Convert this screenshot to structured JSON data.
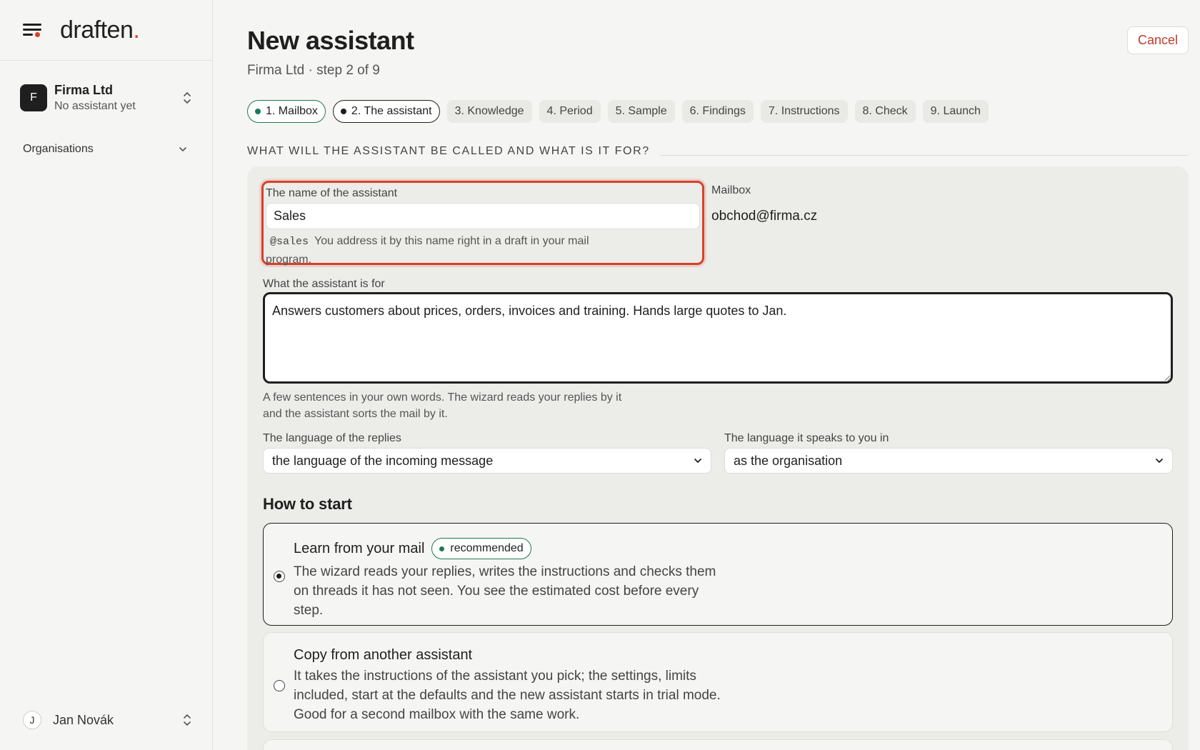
{
  "brand": {
    "logo_text": "draften",
    "logo_dot": "."
  },
  "org": {
    "initial": "F",
    "name": "Firma Ltd",
    "status": "No assistant yet"
  },
  "nav": {
    "organisations_label": "Organisations"
  },
  "user": {
    "initial": "J",
    "name": "Jan Novák"
  },
  "page": {
    "title": "New assistant",
    "subtitle": "Firma Ltd · step 2 of 9",
    "cancel_label": "Cancel"
  },
  "steps": [
    {
      "label": "1. Mailbox",
      "state": "done"
    },
    {
      "label": "2. The assistant",
      "state": "current"
    },
    {
      "label": "3. Knowledge",
      "state": "todo"
    },
    {
      "label": "4. Period",
      "state": "todo"
    },
    {
      "label": "5. Sample",
      "state": "todo"
    },
    {
      "label": "6. Findings",
      "state": "todo"
    },
    {
      "label": "7. Instructions",
      "state": "todo"
    },
    {
      "label": "8. Check",
      "state": "todo"
    },
    {
      "label": "9. Launch",
      "state": "todo"
    }
  ],
  "section": {
    "heading": "WHAT WILL THE ASSISTANT BE CALLED AND WHAT IS IT FOR?"
  },
  "form": {
    "name_label": "The name of the assistant",
    "name_value": "Sales",
    "name_handle": "@sales",
    "name_hint": "You address it by this name right in a draft in your mail program.",
    "mailbox_label": "Mailbox",
    "mailbox_value": "obchod@firma.cz",
    "purpose_label": "What the assistant is for",
    "purpose_value": "Answers customers about prices, orders, invoices and training. Hands large quotes to Jan.",
    "purpose_hint": "A few sentences in your own words. The wizard reads your replies by it and the assistant sorts the mail by it.",
    "reply_lang_label": "The language of the replies",
    "reply_lang_value": "the language of the incoming message",
    "ui_lang_label": "The language it speaks to you in",
    "ui_lang_value": "as the organisation"
  },
  "start": {
    "heading": "How to start",
    "options": [
      {
        "title": "Learn from your mail",
        "badge": "recommended",
        "description": "The wizard reads your replies, writes the instructions and checks them on threads it has not seen. You see the estimated cost before every step.",
        "selected": true
      },
      {
        "title": "Copy from another assistant",
        "description": "It takes the instructions of the assistant you pick; the settings, limits included, start at the defaults and the new assistant starts in trial mode. Good for a second mailbox with the same work.",
        "selected": false
      }
    ]
  },
  "colors": {
    "accent": "#d8402a",
    "success": "#1d7a53",
    "ink": "#1f1f1f",
    "background": "#f5f5f3"
  }
}
